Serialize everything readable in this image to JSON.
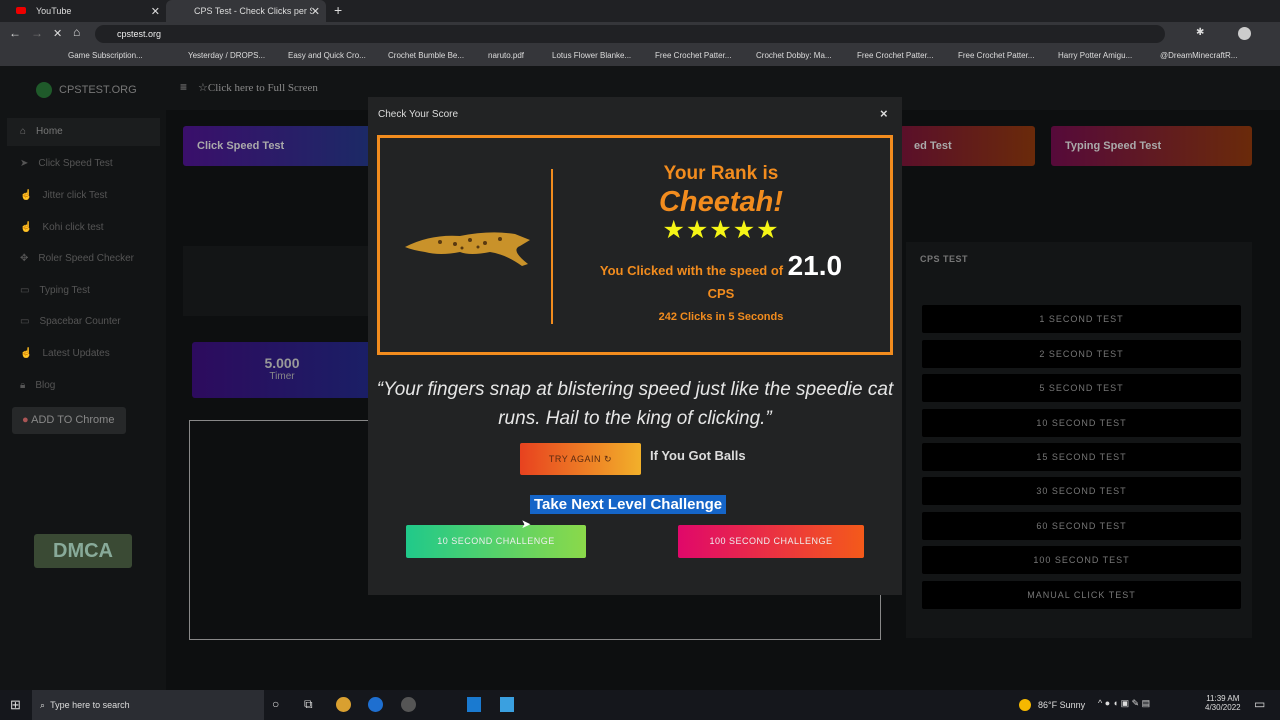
{
  "browser": {
    "tabs": [
      {
        "title": "YouTube"
      },
      {
        "title": "CPS Test - Check Clicks per Secor"
      }
    ],
    "url": "cpstest.org",
    "bookmarks": [
      "Game Subscription...",
      "Yesterday / DROPS...",
      "Easy and Quick Cro...",
      "Crochet Bumble Be...",
      "naruto.pdf",
      "Lotus Flower Blanke...",
      "Free Crochet Patter...",
      "Crochet Dobby: Ma...",
      "Free Crochet Patter...",
      "Free Crochet Patter...",
      "Harry Potter Amigu...",
      "@DreamMinecraftR..."
    ]
  },
  "site": {
    "logo": "CPSTEST.ORG",
    "fullscreen": "Click here to Full Screen",
    "sidebar": [
      {
        "label": "Home",
        "icon": "home-icon"
      },
      {
        "label": "Click Speed Test",
        "icon": "cursor-icon"
      },
      {
        "label": "Jitter click Test",
        "icon": "hand-icon"
      },
      {
        "label": "Kohi click test",
        "icon": "hand-icon"
      },
      {
        "label": "Roler Speed Checker",
        "icon": "gear-icon"
      },
      {
        "label": "Typing Test",
        "icon": "keyboard-icon"
      },
      {
        "label": "Spacebar Counter",
        "icon": "keyboard-icon"
      },
      {
        "label": "Latest Updates",
        "icon": "hand-icon"
      },
      {
        "label": "Blog",
        "icon": "lock-icon"
      }
    ],
    "add_chrome": "ADD TO Chrome",
    "dmca": "DMCA",
    "header_buttons": [
      "Click Speed Test",
      "ed Test",
      "Typing Speed Test"
    ],
    "timer_value": "5.000",
    "timer_label": "Timer",
    "cps_panel_title": "CPS TEST",
    "tests": [
      "1 SECOND TEST",
      "2 SECOND TEST",
      "5 SECOND TEST",
      "10 SECOND TEST",
      "15 SECOND TEST",
      "30 SECOND TEST",
      "60 SECOND TEST",
      "100 SECOND TEST",
      "MANUAL CLICK TEST"
    ]
  },
  "modal": {
    "title": "Check Your Score",
    "close": "×",
    "rank_prefix": "Your Rank is",
    "rank": "Cheetah!",
    "stars": 5,
    "speed_prefix": "You Clicked with the speed of",
    "speed": "21.0",
    "unit": "CPS",
    "summary": "242 Clicks in 5 Seconds",
    "quote": "“Your fingers snap at blistering speed just like the speedie cat runs. Hail to the king of clicking.”",
    "try_again": "TRY AGAIN ↻",
    "balls": "If You Got Balls",
    "next_level": "Take Next Level Challenge",
    "ch10": "10 SECOND CHALLENGE",
    "ch100": "100 SECOND CHALLENGE",
    "accent": "#f28c1e"
  },
  "taskbar": {
    "search": "Type here to search",
    "weather": "86°F  Sunny",
    "time": "11:39 AM",
    "date": "4/30/2022"
  }
}
